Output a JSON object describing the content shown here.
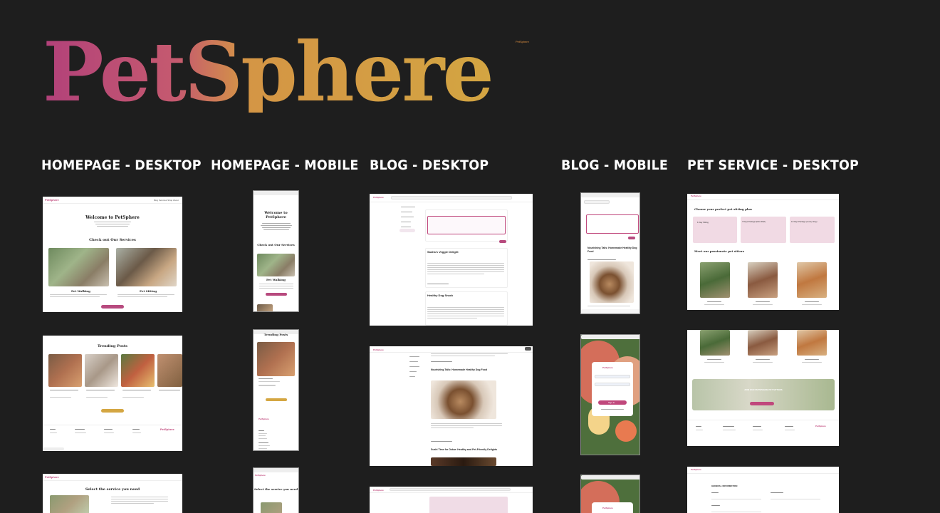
{
  "brand": {
    "name": "PetSphere",
    "tiny_label": "PetSphere"
  },
  "columns": [
    {
      "title": "HOMEPAGE - DESKTOP"
    },
    {
      "title": "HOMEPAGE - MOBILE"
    },
    {
      "title": "BLOG  - DESKTOP"
    },
    {
      "title": "BLOG  - MOBILE"
    },
    {
      "title": "PET SERVICE - DESKTOP"
    }
  ],
  "home_desktop": {
    "logo": "PetSphere",
    "nav": [
      "Blog",
      "Services",
      "Shop",
      "About"
    ],
    "welcome": "Welcome to PetSphere",
    "services_title": "Check out Our Services",
    "service1": "Pet Walking",
    "service2": "Pet Sitting",
    "trending": "Trending Posts",
    "service_select": "Select the service you need"
  },
  "home_mobile": {
    "welcome": "Welcome to PetSphere",
    "services_title": "Check out Our Services",
    "service1": "Pet Walking",
    "trending": "Trending Posts",
    "service_select": "Select the service you need"
  },
  "blog_desktop": {
    "post1": "Sasha's Veggie Delight",
    "post2": "Healthy Dog Snack",
    "post3": "Nourishing Tails: Homemade Healthy Dog Food",
    "post4": "Sushi Time for Oskar: Healthy and Pet-Friendly Delights"
  },
  "blog_mobile": {
    "post1": "Nourishing Tails: Homemade Healthy Dog Food",
    "sign_in": "Sign In"
  },
  "pet_service": {
    "plans_title": "Choose your perfect pet sitting plan",
    "plan1": "1 Day Sitting",
    "plan2": "7 Days Package (Most Paid)",
    "plan3": "14 Days Package (Luxury Stay)",
    "sitters_title": "Meet our passionate pet sitters",
    "join_banner": "JOIN OUR PETSPHERE PET SITTERS",
    "general_info": "GENERAL INFORMATION"
  }
}
